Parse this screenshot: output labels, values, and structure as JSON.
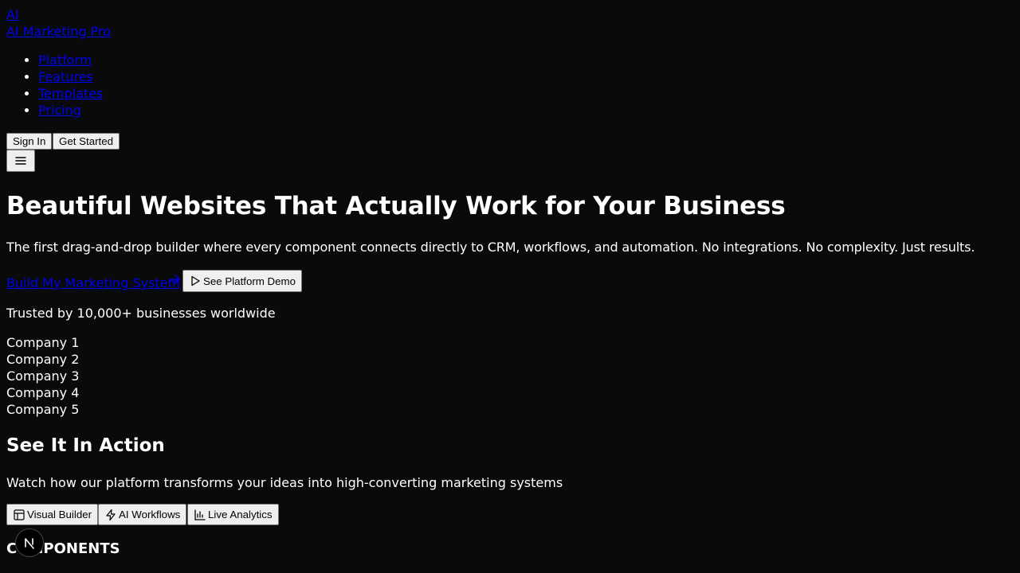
{
  "header": {
    "logo_mark": "AI",
    "brand": "AI Marketing Pro",
    "nav": [
      "Platform",
      "Features",
      "Templates",
      "Pricing"
    ],
    "sign_in": "Sign In",
    "get_started": "Get Started"
  },
  "hero": {
    "title": "Beautiful Websites That Actually Work for Your Business",
    "subtitle": "The first drag-and-drop builder where every component connects directly to CRM, workflows, and automation. No integrations. No complexity. Just results.",
    "cta_primary": "Build My Marketing System",
    "cta_secondary": "See Platform Demo",
    "trusted": "Trusted by 10,000+ businesses worldwide",
    "companies": [
      "Company 1",
      "Company 2",
      "Company 3",
      "Company 4",
      "Company 5"
    ]
  },
  "demo": {
    "title": "See It In Action",
    "subtitle": "Watch how our platform transforms your ideas into high-converting marketing systems",
    "tabs": [
      "Visual Builder",
      "AI Workflows",
      "Live Analytics"
    ],
    "section_label": "COMPONENTS"
  },
  "icons": {
    "menu": "menu-icon",
    "arrow": "arrow-right-icon",
    "play": "play-icon",
    "layout": "layout-icon",
    "zap": "zap-icon",
    "chart": "bar-chart-icon",
    "next": "next-logo-icon"
  }
}
